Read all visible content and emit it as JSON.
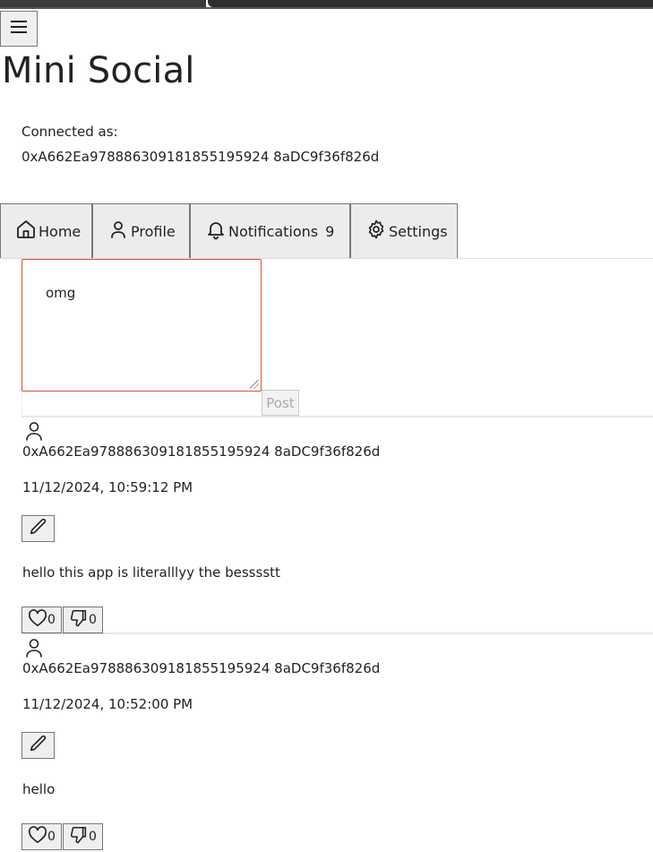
{
  "header": {
    "title": "Mini Social",
    "connected_label": "Connected as:",
    "connected_address": "0xA662Ea978886309181855195924 8aDC9f36f826d"
  },
  "tabs": [
    {
      "label": "Home",
      "icon": "home-icon"
    },
    {
      "label": "Profile",
      "icon": "user-icon"
    },
    {
      "label": "Notifications",
      "icon": "bell-icon",
      "badge": "9"
    },
    {
      "label": "Settings",
      "icon": "gear-icon"
    }
  ],
  "composer": {
    "value": "omg",
    "post_label": "Post"
  },
  "posts": [
    {
      "author": "0xA662Ea978886309181855195924 8aDC9f36f826d",
      "timestamp": "11/12/2024, 10:59:12 PM",
      "content": "hello this app is literalllyy the besssstt",
      "likes": "0",
      "dislikes": "0"
    },
    {
      "author": "0xA662Ea978886309181855195924 8aDC9f36f826d",
      "timestamp": "11/12/2024, 10:52:00 PM",
      "content": "hello",
      "likes": "0",
      "dislikes": "0"
    }
  ],
  "colors": {
    "composer_border": "#e0502a",
    "button_bg": "#efefef"
  }
}
